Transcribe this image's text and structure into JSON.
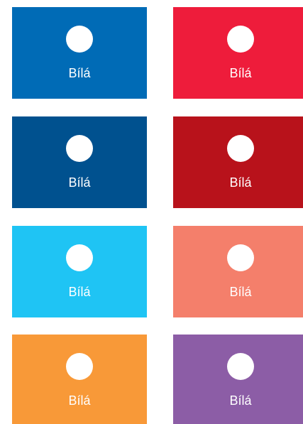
{
  "swatches": [
    {
      "label": "Bílá",
      "color": "#006bb6",
      "dot_color": "#ffffff"
    },
    {
      "label": "Bílá",
      "color": "#ee1c3b",
      "dot_color": "#ffffff"
    },
    {
      "label": "Bílá",
      "color": "#00518f",
      "dot_color": "#ffffff"
    },
    {
      "label": "Bílá",
      "color": "#b8121b",
      "dot_color": "#ffffff"
    },
    {
      "label": "Bílá",
      "color": "#1fc4f4",
      "dot_color": "#ffffff"
    },
    {
      "label": "Bílá",
      "color": "#f47f6b",
      "dot_color": "#ffffff"
    },
    {
      "label": "Bílá",
      "color": "#f89938",
      "dot_color": "#ffffff"
    },
    {
      "label": "Bílá",
      "color": "#8c5da6",
      "dot_color": "#ffffff"
    }
  ]
}
